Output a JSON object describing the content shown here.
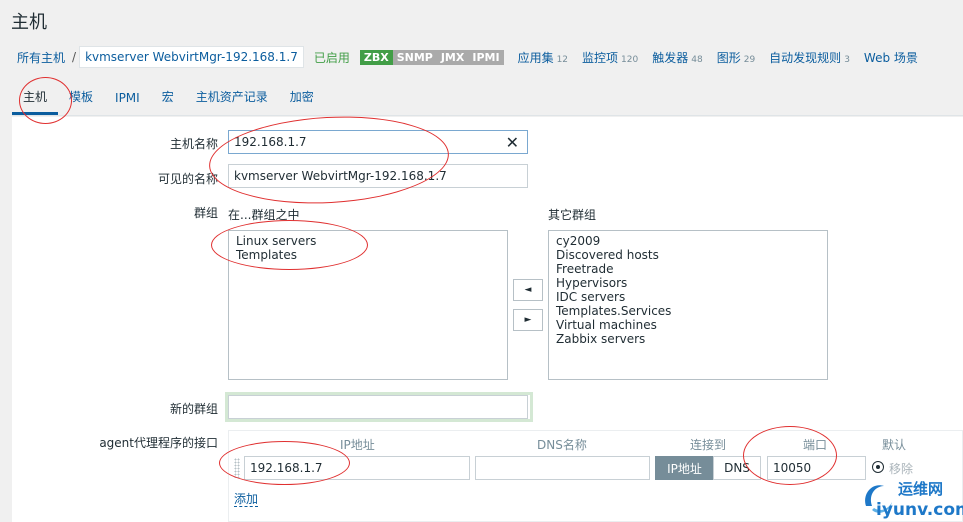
{
  "page": {
    "title": "主机"
  },
  "breadcrumb": {
    "all_hosts": "所有主机",
    "separator": "/",
    "current_host": "kvmserver WebvirtMgr-192.168.1.7",
    "status": "已启用",
    "availability": [
      "ZBX",
      "SNMP",
      "JMX",
      "IPMI"
    ],
    "items": [
      {
        "label": "应用集",
        "count": "12"
      },
      {
        "label": "监控项",
        "count": "120"
      },
      {
        "label": "触发器",
        "count": "48"
      },
      {
        "label": "图形",
        "count": "29"
      },
      {
        "label": "自动发现规则",
        "count": "3"
      },
      {
        "label": "Web 场景",
        "count": ""
      }
    ]
  },
  "tabs": [
    "主机",
    "模板",
    "IPMI",
    "宏",
    "主机资产记录",
    "加密"
  ],
  "form": {
    "host_name_label": "主机名称",
    "host_name_value": "192.168.1.7",
    "visible_name_label": "可见的名称",
    "visible_name_value": "kvmserver WebvirtMgr-192.168.1.7",
    "groups_label": "群组",
    "in_groups_label": "在...群组之中",
    "other_groups_label": "其它群组",
    "in_groups": [
      "Linux servers",
      "Templates"
    ],
    "other_groups": [
      "cy2009",
      "Discovered hosts",
      "Freetrade",
      "Hypervisors",
      "IDC servers",
      "Templates.Services",
      "Virtual machines",
      "Zabbix servers"
    ],
    "move_left": "◄",
    "move_right": "►",
    "new_group_label": "新的群组",
    "new_group_value": "",
    "agent_interfaces_label": "agent代理程序的接口",
    "columns": {
      "ip": "IP地址",
      "dns": "DNS名称",
      "connect_to": "连接到",
      "port": "端口",
      "default": "默认"
    },
    "interface": {
      "ip": "192.168.1.7",
      "dns": "",
      "connect_ip": "IP地址",
      "connect_dns": "DNS",
      "port": "10050",
      "remove": "移除"
    },
    "add_label": "添加"
  },
  "watermark": {
    "line1": "运维网",
    "line2": "iyunv.com"
  },
  "colors": {
    "link": "#0b5d9e",
    "enabled": "#429e47",
    "annotation": "#e03030"
  }
}
